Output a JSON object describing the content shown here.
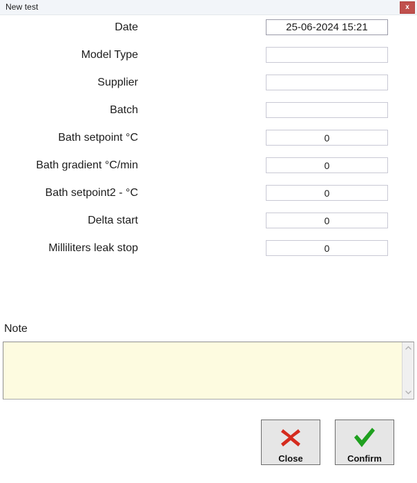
{
  "window": {
    "title": "New test",
    "close_icon": "close-x-icon",
    "close_label": "x",
    "accent_close_bg": "#c0504d"
  },
  "form": {
    "rows": [
      {
        "label": "Date",
        "value": "25-06-2024 15:21",
        "placeholder": "",
        "type": "datetime"
      },
      {
        "label": "Model Type",
        "value": "",
        "placeholder": "",
        "type": "text"
      },
      {
        "label": "Supplier",
        "value": "",
        "placeholder": "",
        "type": "text"
      },
      {
        "label": "Batch",
        "value": "",
        "placeholder": "",
        "type": "text"
      },
      {
        "label": "Bath setpoint °C",
        "value": "0",
        "placeholder": "",
        "type": "number"
      },
      {
        "label": "Bath gradient °C/min",
        "value": "0",
        "placeholder": "",
        "type": "number"
      },
      {
        "label": "Bath setpoint2 - °C",
        "value": "0",
        "placeholder": "",
        "type": "number"
      },
      {
        "label": "Delta start",
        "value": "0",
        "placeholder": "",
        "type": "number"
      },
      {
        "label": "Milliliters leak stop",
        "value": "0",
        "placeholder": "",
        "type": "number"
      }
    ]
  },
  "note": {
    "label": "Note",
    "value": "",
    "placeholder": "",
    "background": "#fdfbe0",
    "scrollbar": {
      "up_icon": "chevron-up-icon",
      "down_icon": "chevron-down-icon"
    }
  },
  "actions": {
    "close": {
      "label": "Close",
      "icon": "red-cross-icon",
      "color": "#d52b1e"
    },
    "confirm": {
      "label": "Confirm",
      "icon": "green-check-icon",
      "color": "#1fa01f"
    }
  }
}
